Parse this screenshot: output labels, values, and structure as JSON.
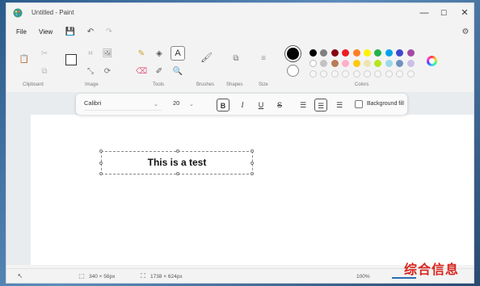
{
  "window": {
    "title": "Untitled - Paint"
  },
  "window_controls": {
    "minimize": "—",
    "maximize": "☐",
    "close": "✕"
  },
  "menu": {
    "file": "File",
    "view": "View"
  },
  "ribbon": {
    "groups": {
      "clipboard": "Clipboard",
      "image": "Image",
      "tools": "Tools",
      "brushes": "Brushes",
      "shapes": "Shapes",
      "size": "Size",
      "colors": "Colors"
    },
    "text_tool": "A",
    "palette_row1": [
      "#000000",
      "#7f7f7f",
      "#880015",
      "#ed1c24",
      "#ff7f27",
      "#fff200",
      "#22b14c",
      "#00a2e8",
      "#3f48cc",
      "#a349a4"
    ],
    "palette_row2": [
      "#ffffff",
      "#c3c3c3",
      "#b97a57",
      "#ffaec9",
      "#ffc90e",
      "#efe4b0",
      "#b5e61d",
      "#99d9ea",
      "#7092be",
      "#c8bfe7"
    ],
    "palette_row3_empty": 10
  },
  "text_toolbar": {
    "font": "Calibri",
    "size": "20",
    "bold": "B",
    "italic": "I",
    "underline": "U",
    "strike": "S",
    "background_fill": "Background fill"
  },
  "canvas": {
    "text": "This is a test"
  },
  "status": {
    "selection_size": "340 × 56px",
    "canvas_size": "1738 × 624px",
    "zoom": "100%"
  },
  "watermark": "综合信息"
}
